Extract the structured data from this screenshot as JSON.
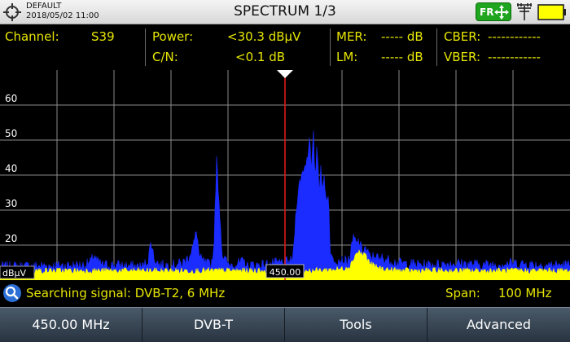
{
  "header": {
    "profile_name": "DEFAULT",
    "datetime": "2018/05/02 11:00",
    "title": "SPECTRUM 1/3",
    "badge_label": "FR",
    "accent_color": "#1fa51f",
    "battery_color": "#ffff00"
  },
  "measurements": {
    "channel": {
      "label": "Channel:",
      "value": "S39"
    },
    "power": {
      "label": "Power:",
      "value": "<30.3 dBµV"
    },
    "cn": {
      "label": "C/N:",
      "value": "<0.1 dB"
    },
    "mer": {
      "label": "MER:",
      "value": "----- dB"
    },
    "lm": {
      "label": "LM:",
      "value": "----- dB"
    },
    "cber": {
      "label": "CBER:",
      "value": "------------"
    },
    "vber": {
      "label": "VBER:",
      "value": "------------"
    }
  },
  "chart_data": {
    "type": "area",
    "y_unit_label": "dBµV",
    "y_ticks": [
      "20",
      "30",
      "40",
      "50",
      "60"
    ],
    "ylim": [
      10,
      70
    ],
    "x_span_mhz": 100,
    "x_center_mhz": 450,
    "xlim": [
      400,
      500
    ],
    "marker_freq_mhz": 450,
    "marker_label": "450.00",
    "grid": true,
    "series": [
      {
        "color": "#1a2cff",
        "x": [
          400,
          415,
          416,
          416.5,
          417,
          418,
          420,
          425,
          426,
          426.5,
          427,
          428,
          430,
          432,
          433,
          434,
          434.5,
          435,
          436,
          437,
          437.5,
          438,
          439,
          440,
          442,
          443,
          443.6,
          444,
          446,
          451,
          451.4,
          452,
          452.5,
          453,
          454,
          454.3,
          454.6,
          455,
          455.3,
          455.6,
          456,
          456.3,
          456.6,
          456.9,
          457.2,
          457.6,
          458,
          461,
          461.5,
          462,
          462.5,
          463,
          463.5,
          464,
          465,
          466,
          466.5,
          467,
          470,
          475,
          480,
          485,
          490,
          495,
          500
        ],
        "y": [
          13.5,
          14,
          15,
          17,
          15,
          14,
          14,
          13.5,
          15.5,
          21,
          16,
          14,
          14,
          14.5,
          16,
          20,
          24,
          16,
          14.5,
          14,
          18,
          44,
          17,
          14,
          14.5,
          15,
          13,
          14,
          14,
          15,
          16,
          31,
          37,
          40,
          45,
          52,
          40,
          51,
          38,
          49,
          36,
          43,
          34,
          40,
          32,
          35,
          16,
          15,
          17,
          22,
          20,
          21,
          18,
          19,
          16,
          17,
          15,
          16,
          14.5,
          14,
          14.5,
          14,
          14.5,
          14,
          14
        ]
      },
      {
        "color": "#ffff00",
        "x": [
          400,
          410,
          420,
          430,
          440,
          449,
          450,
          455,
          460,
          461.5,
          462,
          462.5,
          463,
          463.5,
          464,
          464.5,
          465,
          466,
          467,
          470,
          480,
          490,
          500
        ],
        "y": [
          12.5,
          12.5,
          12.5,
          12.5,
          12.5,
          12.5,
          12.5,
          12.5,
          13,
          14,
          16,
          17.5,
          18,
          17,
          17.5,
          15.5,
          14.5,
          13.5,
          13,
          12.5,
          12.5,
          12.5,
          12.5
        ]
      }
    ]
  },
  "status": {
    "message": "Searching signal: DVB-T2, 6 MHz",
    "span_label": "Span:",
    "span_value": "100 MHz"
  },
  "softkeys": [
    {
      "label": "450.00 MHz"
    },
    {
      "label": "DVB-T"
    },
    {
      "label": "Tools"
    },
    {
      "label": "Advanced"
    }
  ]
}
